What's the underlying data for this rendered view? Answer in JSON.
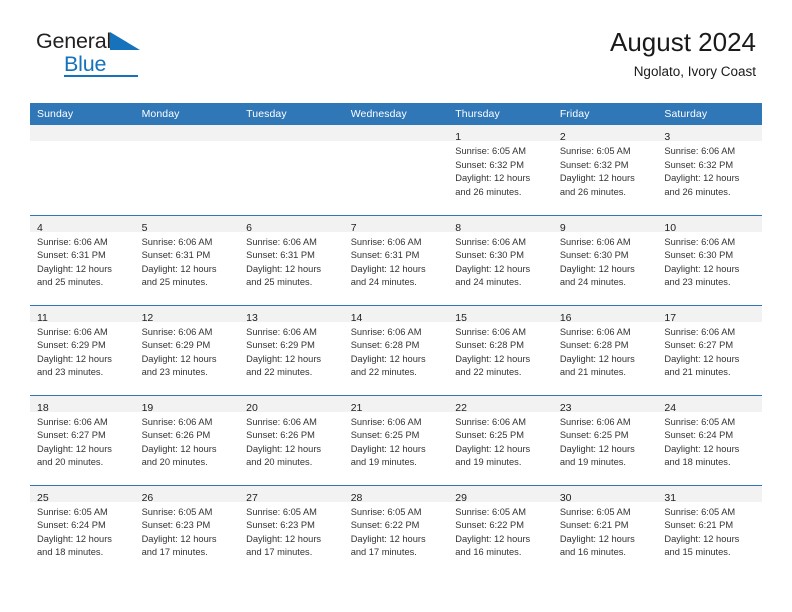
{
  "brand": {
    "name_part1": "General",
    "name_part2": "Blue",
    "flag_icon": "triangle-flag-icon",
    "accent_color": "#1572bb"
  },
  "header": {
    "title": "August 2024",
    "subtitle": "Ngolato, Ivory Coast"
  },
  "theme": {
    "header_blue": "#3077b8",
    "daynum_band": "#f2f2f2",
    "text": "#333333"
  },
  "weekday_headers": [
    "Sunday",
    "Monday",
    "Tuesday",
    "Wednesday",
    "Thursday",
    "Friday",
    "Saturday"
  ],
  "weeks": [
    [
      {
        "day": "",
        "lines": []
      },
      {
        "day": "",
        "lines": []
      },
      {
        "day": "",
        "lines": []
      },
      {
        "day": "",
        "lines": []
      },
      {
        "day": "1",
        "lines": [
          "Sunrise: 6:05 AM",
          "Sunset: 6:32 PM",
          "Daylight: 12 hours",
          "and 26 minutes."
        ]
      },
      {
        "day": "2",
        "lines": [
          "Sunrise: 6:05 AM",
          "Sunset: 6:32 PM",
          "Daylight: 12 hours",
          "and 26 minutes."
        ]
      },
      {
        "day": "3",
        "lines": [
          "Sunrise: 6:06 AM",
          "Sunset: 6:32 PM",
          "Daylight: 12 hours",
          "and 26 minutes."
        ]
      }
    ],
    [
      {
        "day": "4",
        "lines": [
          "Sunrise: 6:06 AM",
          "Sunset: 6:31 PM",
          "Daylight: 12 hours",
          "and 25 minutes."
        ]
      },
      {
        "day": "5",
        "lines": [
          "Sunrise: 6:06 AM",
          "Sunset: 6:31 PM",
          "Daylight: 12 hours",
          "and 25 minutes."
        ]
      },
      {
        "day": "6",
        "lines": [
          "Sunrise: 6:06 AM",
          "Sunset: 6:31 PM",
          "Daylight: 12 hours",
          "and 25 minutes."
        ]
      },
      {
        "day": "7",
        "lines": [
          "Sunrise: 6:06 AM",
          "Sunset: 6:31 PM",
          "Daylight: 12 hours",
          "and 24 minutes."
        ]
      },
      {
        "day": "8",
        "lines": [
          "Sunrise: 6:06 AM",
          "Sunset: 6:30 PM",
          "Daylight: 12 hours",
          "and 24 minutes."
        ]
      },
      {
        "day": "9",
        "lines": [
          "Sunrise: 6:06 AM",
          "Sunset: 6:30 PM",
          "Daylight: 12 hours",
          "and 24 minutes."
        ]
      },
      {
        "day": "10",
        "lines": [
          "Sunrise: 6:06 AM",
          "Sunset: 6:30 PM",
          "Daylight: 12 hours",
          "and 23 minutes."
        ]
      }
    ],
    [
      {
        "day": "11",
        "lines": [
          "Sunrise: 6:06 AM",
          "Sunset: 6:29 PM",
          "Daylight: 12 hours",
          "and 23 minutes."
        ]
      },
      {
        "day": "12",
        "lines": [
          "Sunrise: 6:06 AM",
          "Sunset: 6:29 PM",
          "Daylight: 12 hours",
          "and 23 minutes."
        ]
      },
      {
        "day": "13",
        "lines": [
          "Sunrise: 6:06 AM",
          "Sunset: 6:29 PM",
          "Daylight: 12 hours",
          "and 22 minutes."
        ]
      },
      {
        "day": "14",
        "lines": [
          "Sunrise: 6:06 AM",
          "Sunset: 6:28 PM",
          "Daylight: 12 hours",
          "and 22 minutes."
        ]
      },
      {
        "day": "15",
        "lines": [
          "Sunrise: 6:06 AM",
          "Sunset: 6:28 PM",
          "Daylight: 12 hours",
          "and 22 minutes."
        ]
      },
      {
        "day": "16",
        "lines": [
          "Sunrise: 6:06 AM",
          "Sunset: 6:28 PM",
          "Daylight: 12 hours",
          "and 21 minutes."
        ]
      },
      {
        "day": "17",
        "lines": [
          "Sunrise: 6:06 AM",
          "Sunset: 6:27 PM",
          "Daylight: 12 hours",
          "and 21 minutes."
        ]
      }
    ],
    [
      {
        "day": "18",
        "lines": [
          "Sunrise: 6:06 AM",
          "Sunset: 6:27 PM",
          "Daylight: 12 hours",
          "and 20 minutes."
        ]
      },
      {
        "day": "19",
        "lines": [
          "Sunrise: 6:06 AM",
          "Sunset: 6:26 PM",
          "Daylight: 12 hours",
          "and 20 minutes."
        ]
      },
      {
        "day": "20",
        "lines": [
          "Sunrise: 6:06 AM",
          "Sunset: 6:26 PM",
          "Daylight: 12 hours",
          "and 20 minutes."
        ]
      },
      {
        "day": "21",
        "lines": [
          "Sunrise: 6:06 AM",
          "Sunset: 6:25 PM",
          "Daylight: 12 hours",
          "and 19 minutes."
        ]
      },
      {
        "day": "22",
        "lines": [
          "Sunrise: 6:06 AM",
          "Sunset: 6:25 PM",
          "Daylight: 12 hours",
          "and 19 minutes."
        ]
      },
      {
        "day": "23",
        "lines": [
          "Sunrise: 6:06 AM",
          "Sunset: 6:25 PM",
          "Daylight: 12 hours",
          "and 19 minutes."
        ]
      },
      {
        "day": "24",
        "lines": [
          "Sunrise: 6:05 AM",
          "Sunset: 6:24 PM",
          "Daylight: 12 hours",
          "and 18 minutes."
        ]
      }
    ],
    [
      {
        "day": "25",
        "lines": [
          "Sunrise: 6:05 AM",
          "Sunset: 6:24 PM",
          "Daylight: 12 hours",
          "and 18 minutes."
        ]
      },
      {
        "day": "26",
        "lines": [
          "Sunrise: 6:05 AM",
          "Sunset: 6:23 PM",
          "Daylight: 12 hours",
          "and 17 minutes."
        ]
      },
      {
        "day": "27",
        "lines": [
          "Sunrise: 6:05 AM",
          "Sunset: 6:23 PM",
          "Daylight: 12 hours",
          "and 17 minutes."
        ]
      },
      {
        "day": "28",
        "lines": [
          "Sunrise: 6:05 AM",
          "Sunset: 6:22 PM",
          "Daylight: 12 hours",
          "and 17 minutes."
        ]
      },
      {
        "day": "29",
        "lines": [
          "Sunrise: 6:05 AM",
          "Sunset: 6:22 PM",
          "Daylight: 12 hours",
          "and 16 minutes."
        ]
      },
      {
        "day": "30",
        "lines": [
          "Sunrise: 6:05 AM",
          "Sunset: 6:21 PM",
          "Daylight: 12 hours",
          "and 16 minutes."
        ]
      },
      {
        "day": "31",
        "lines": [
          "Sunrise: 6:05 AM",
          "Sunset: 6:21 PM",
          "Daylight: 12 hours",
          "and 15 minutes."
        ]
      }
    ]
  ]
}
